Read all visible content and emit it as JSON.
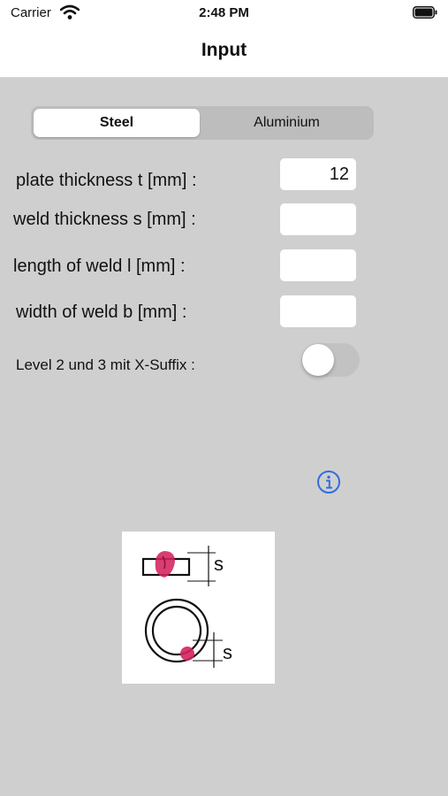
{
  "status_bar": {
    "carrier": "Carrier",
    "time": "2:48 PM",
    "icons": [
      "wifi-icon",
      "battery-icon"
    ]
  },
  "nav": {
    "title": "Input"
  },
  "material_selector": {
    "options": [
      "Steel",
      "Aluminium"
    ],
    "selected": "Steel"
  },
  "fields": [
    {
      "label": "plate thickness t [mm] :",
      "value": "12"
    },
    {
      "label": "weld thickness s [mm] :",
      "value": ""
    },
    {
      "label": "length of weld l [mm] :",
      "value": ""
    },
    {
      "label": "width of weld b [mm] :",
      "value": ""
    }
  ],
  "toggle": {
    "label": "Level 2 und 3 mit X-Suffix  :",
    "on": false
  },
  "info": {
    "icon": "info-icon",
    "color": "#2f6fe0"
  },
  "diagram": {
    "labels": [
      "s",
      "s"
    ],
    "weld_color": "#d4225e"
  }
}
